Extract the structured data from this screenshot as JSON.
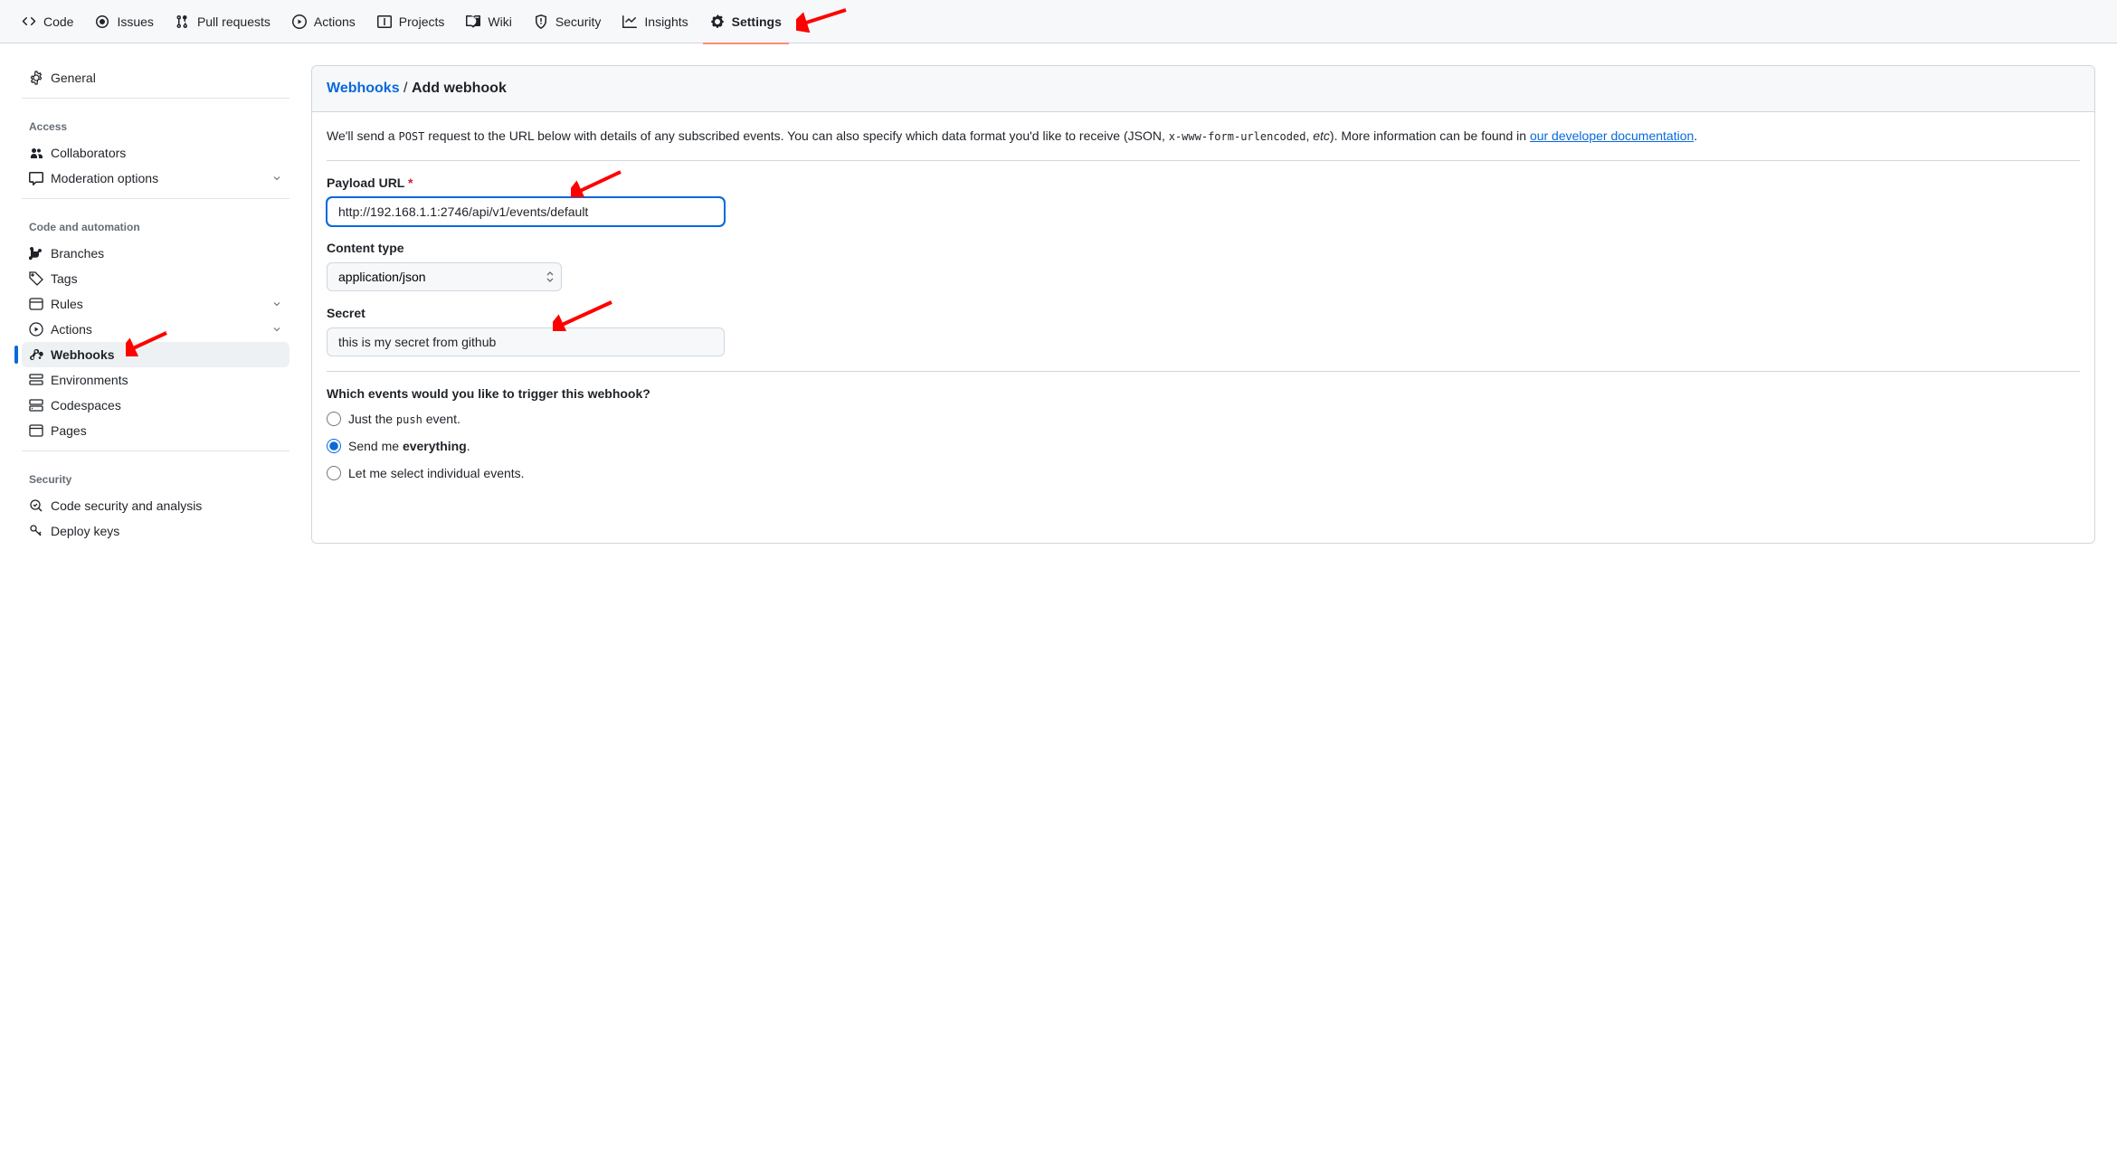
{
  "topnav": {
    "items": [
      {
        "icon": "code",
        "label": "Code"
      },
      {
        "icon": "issue",
        "label": "Issues"
      },
      {
        "icon": "pr",
        "label": "Pull requests"
      },
      {
        "icon": "play",
        "label": "Actions"
      },
      {
        "icon": "project",
        "label": "Projects"
      },
      {
        "icon": "book",
        "label": "Wiki"
      },
      {
        "icon": "shield",
        "label": "Security"
      },
      {
        "icon": "graph",
        "label": "Insights"
      },
      {
        "icon": "gear",
        "label": "Settings",
        "active": true
      }
    ]
  },
  "sidebar": {
    "general_label": "General",
    "sections": {
      "access": {
        "heading": "Access",
        "items": [
          {
            "icon": "people",
            "label": "Collaborators"
          },
          {
            "icon": "comment",
            "label": "Moderation options",
            "expandable": true
          }
        ]
      },
      "code": {
        "heading": "Code and automation",
        "items": [
          {
            "icon": "branch",
            "label": "Branches"
          },
          {
            "icon": "tag",
            "label": "Tags"
          },
          {
            "icon": "rules",
            "label": "Rules",
            "expandable": true
          },
          {
            "icon": "play",
            "label": "Actions",
            "expandable": true
          },
          {
            "icon": "webhook",
            "label": "Webhooks",
            "active": true
          },
          {
            "icon": "env",
            "label": "Environments"
          },
          {
            "icon": "codespaces",
            "label": "Codespaces"
          },
          {
            "icon": "browser",
            "label": "Pages"
          }
        ]
      },
      "security": {
        "heading": "Security",
        "items": [
          {
            "icon": "codescan",
            "label": "Code security and analysis"
          },
          {
            "icon": "key",
            "label": "Deploy keys"
          }
        ]
      }
    }
  },
  "breadcrumb": {
    "parent": "Webhooks",
    "sep": " / ",
    "current": "Add webhook"
  },
  "help": {
    "text_prefix": "We'll send a ",
    "post_code": "POST",
    "text_mid1": " request to the URL below with details of any subscribed events. You can also specify which data format you'd like to receive (JSON, ",
    "form_code": "x-www-form-urlencoded",
    "text_mid2": ", ",
    "etc_italic": "etc",
    "text_mid3": "). More information can be found in ",
    "link_text": "our developer documentation",
    "text_end": "."
  },
  "form": {
    "payload_url": {
      "label": "Payload URL",
      "required_marker": "*",
      "value": "http://192.168.1.1:2746/api/v1/events/default"
    },
    "content_type": {
      "label": "Content type",
      "selected": "application/json"
    },
    "secret": {
      "label": "Secret",
      "value": "this is my secret from github"
    },
    "events": {
      "heading": "Which events would you like to trigger this webhook?",
      "options": [
        {
          "prefix": "Just the ",
          "code": "push",
          "suffix": " event.",
          "checked": false
        },
        {
          "prefix": "Send me ",
          "bold": "everything",
          "suffix": ".",
          "checked": true
        },
        {
          "prefix": "Let me select individual events.",
          "checked": false
        }
      ]
    }
  }
}
